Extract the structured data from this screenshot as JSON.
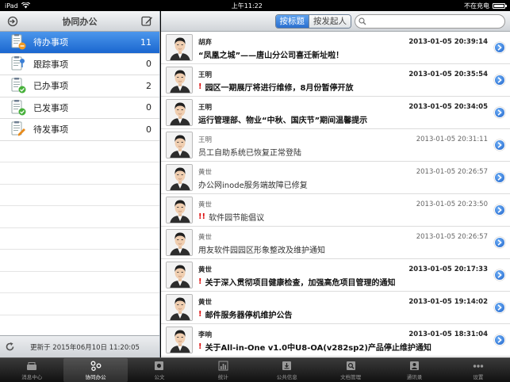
{
  "status_bar": {
    "carrier": "iPad",
    "time": "上午11:22",
    "battery_text": "不在充电"
  },
  "left": {
    "title": "协同办公",
    "items": [
      {
        "label": "待办事项",
        "count": "11",
        "icon": "pending-doc-icon"
      },
      {
        "label": "跟踪事项",
        "count": "0",
        "icon": "tracking-doc-icon"
      },
      {
        "label": "已办事项",
        "count": "2",
        "icon": "done-doc-icon"
      },
      {
        "label": "已发事项",
        "count": "0",
        "icon": "sent-doc-icon"
      },
      {
        "label": "待发事项",
        "count": "0",
        "icon": "draft-doc-icon"
      }
    ],
    "footer_text": "更新于 2015年06月10日 11:20:05"
  },
  "right": {
    "segment": {
      "option1": "按标题",
      "option2": "按发起人"
    },
    "search_placeholder": "",
    "rows": [
      {
        "sender": "胡弃",
        "time": "2013-01-05 20:39:14",
        "subject": "“凤凰之城”——唐山分公司喜迁新址啦！",
        "priority": "",
        "unread": true
      },
      {
        "sender": "王明",
        "time": "2013-01-05 20:35:54",
        "subject": "园区一期展厅将进行维修，8月份暂停开放",
        "priority": "!",
        "unread": true
      },
      {
        "sender": "王明",
        "time": "2013-01-05 20:34:05",
        "subject": "运行管理部、物业“中秋、国庆节”期间温馨提示",
        "priority": "",
        "unread": true
      },
      {
        "sender": "王明",
        "time": "2013-01-05 20:31:11",
        "subject": "员工自助系统已恢复正常登陆",
        "priority": "",
        "unread": false
      },
      {
        "sender": "黄世",
        "time": "2013-01-05 20:26:57",
        "subject": "办公网inode服务端故障已修复",
        "priority": "",
        "unread": false
      },
      {
        "sender": "黄世",
        "time": "2013-01-05 20:23:50",
        "subject": "软件园节能倡议",
        "priority": "!!",
        "unread": false
      },
      {
        "sender": "黄世",
        "time": "2013-01-05 20:26:57",
        "subject": "用友软件园园区形象整改及维护通知",
        "priority": "",
        "unread": false
      },
      {
        "sender": "黄世",
        "time": "2013-01-05 20:17:33",
        "subject": "关于深入贯彻项目健康检查，加强高危项目管理的通知",
        "priority": "!",
        "unread": true
      },
      {
        "sender": "黄世",
        "time": "2013-01-05 19:14:02",
        "subject": "邮件服务器停机维护公告",
        "priority": "!",
        "unread": true
      },
      {
        "sender": "李响",
        "time": "2013-01-05 18:31:04",
        "subject": "关于All-in-One v1.0中U8-OA(v282sp2)产品停止维护通知",
        "priority": "!",
        "unread": true
      }
    ]
  },
  "tabbar": [
    {
      "label": "消息中心",
      "icon": "message-center-icon"
    },
    {
      "label": "协同办公",
      "icon": "collaboration-icon"
    },
    {
      "label": "公文",
      "icon": "official-doc-icon"
    },
    {
      "label": "统计",
      "icon": "statistics-icon"
    },
    {
      "label": "公共信息",
      "icon": "public-info-icon"
    },
    {
      "label": "文档管理",
      "icon": "document-management-icon"
    },
    {
      "label": "通讯录",
      "icon": "address-book-icon"
    },
    {
      "label": "设置",
      "icon": "settings-icon"
    }
  ],
  "colors": {
    "accent": "#2a6fcf",
    "priority": "#dd1111"
  }
}
